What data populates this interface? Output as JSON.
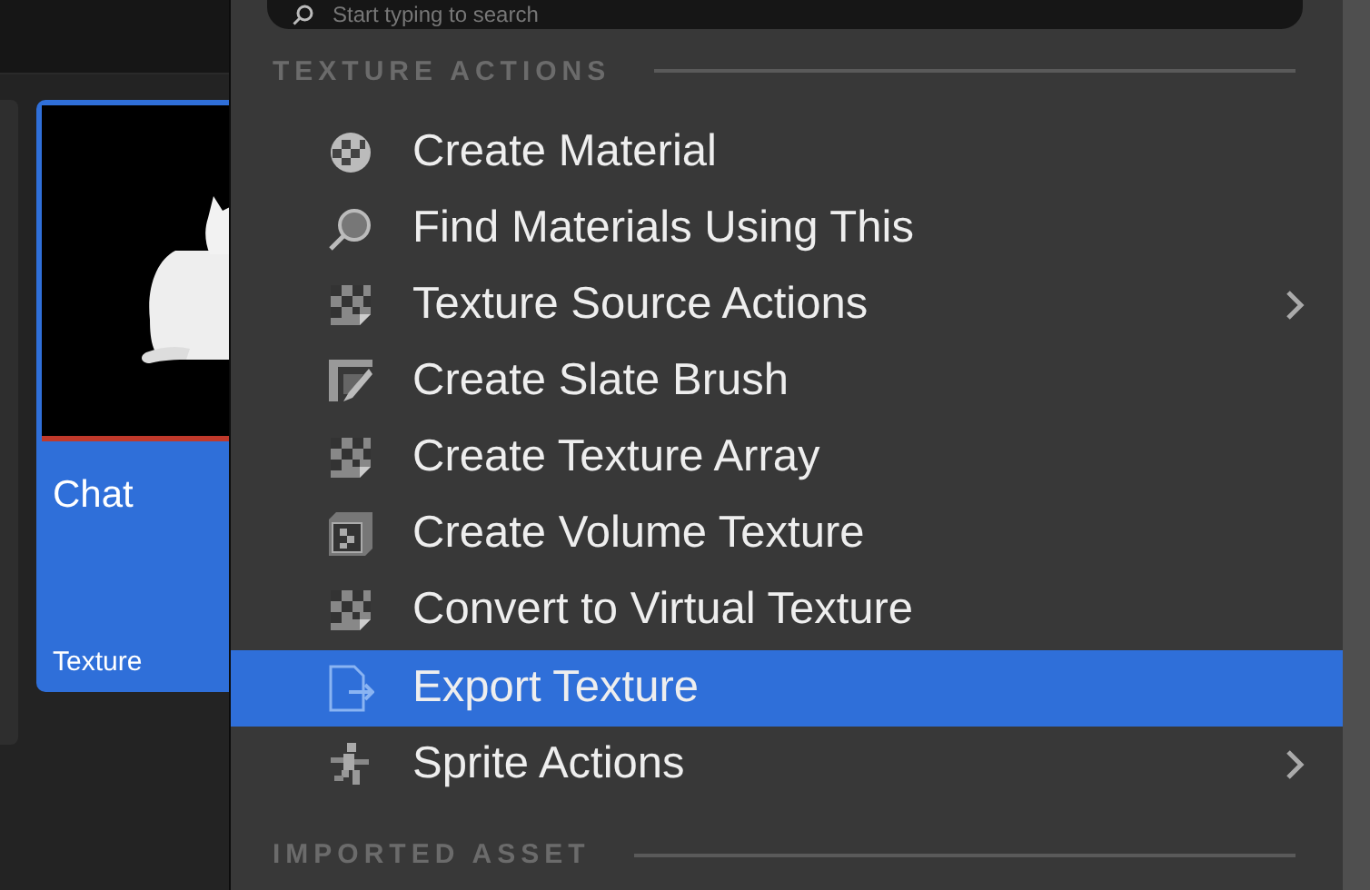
{
  "asset_card": {
    "name": "Chat",
    "type": "Texture",
    "selected": true
  },
  "context_menu": {
    "search": {
      "placeholder": "Start typing to search"
    },
    "sections": [
      {
        "heading": "TEXTURE ACTIONS",
        "items": [
          {
            "label": "Create Material",
            "submenu": false,
            "selected": false
          },
          {
            "label": "Find Materials Using This",
            "submenu": false,
            "selected": false
          },
          {
            "label": "Texture Source Actions",
            "submenu": true,
            "selected": false
          },
          {
            "label": "Create Slate Brush",
            "submenu": false,
            "selected": false
          },
          {
            "label": "Create Texture Array",
            "submenu": false,
            "selected": false
          },
          {
            "label": "Create Volume Texture",
            "submenu": false,
            "selected": false
          },
          {
            "label": "Convert to Virtual Texture",
            "submenu": false,
            "selected": false
          },
          {
            "label": "Export Texture",
            "submenu": false,
            "selected": true
          },
          {
            "label": "Sprite Actions",
            "submenu": true,
            "selected": false
          }
        ]
      },
      {
        "heading": "IMPORTED ASSET"
      }
    ]
  }
}
